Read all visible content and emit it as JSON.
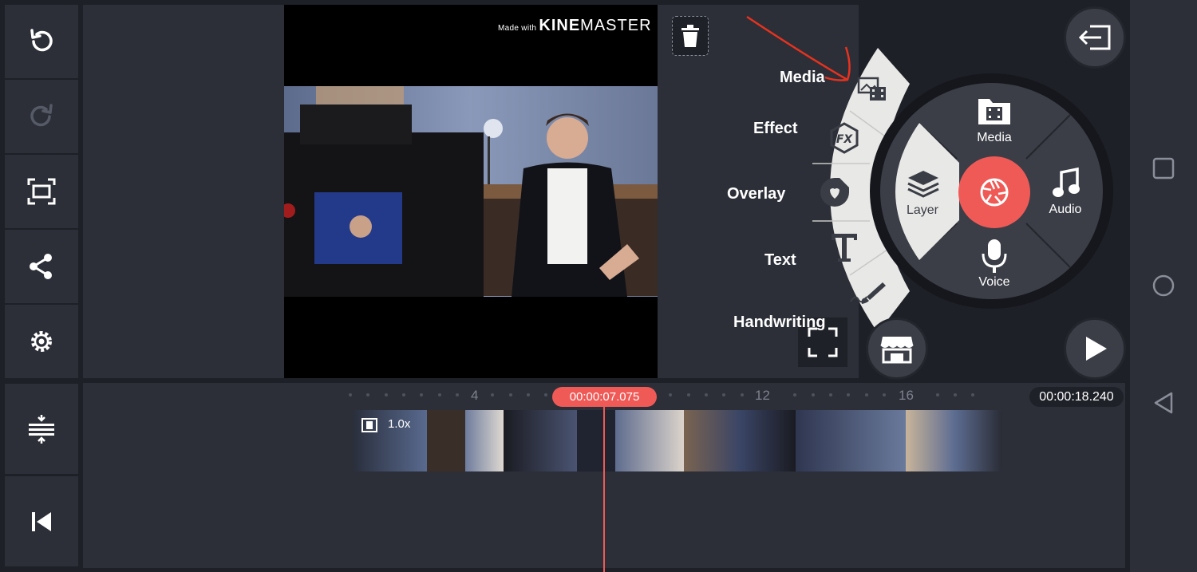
{
  "watermark": {
    "prefix": "Made with",
    "brand_bold": "KINE",
    "brand_light": "MASTER"
  },
  "left_toolbar": [
    {
      "icon": "undo-icon"
    },
    {
      "icon": "redo-icon"
    },
    {
      "icon": "capture-frame-icon"
    },
    {
      "icon": "share-icon"
    },
    {
      "icon": "settings-gear-icon"
    }
  ],
  "left_timeline_tools": [
    {
      "icon": "timeline-expand-icon"
    },
    {
      "icon": "jump-to-start-icon"
    }
  ],
  "media_fan_menu": {
    "items": [
      {
        "label": "Media",
        "icon": "media-browser-icon"
      },
      {
        "label": "Effect",
        "icon": "fx-icon"
      },
      {
        "label": "Overlay",
        "icon": "sticker-icon"
      },
      {
        "label": "Text",
        "icon": "text-icon"
      },
      {
        "label": "Handwriting",
        "icon": "brush-icon"
      }
    ]
  },
  "hub_menu": {
    "layer": "Layer",
    "media": "Media",
    "audio": "Audio",
    "voice": "Voice"
  },
  "timeline": {
    "ruler": [
      "4",
      "12",
      "16"
    ],
    "playhead_time": "00:00:07.075",
    "total_time": "00:00:18.240",
    "clip_speed": "1.0x"
  },
  "colors": {
    "accent": "#ef5a57",
    "panel": "#2c2f38",
    "background": "#1e2027",
    "fan_menu": "#e8e8e6"
  }
}
